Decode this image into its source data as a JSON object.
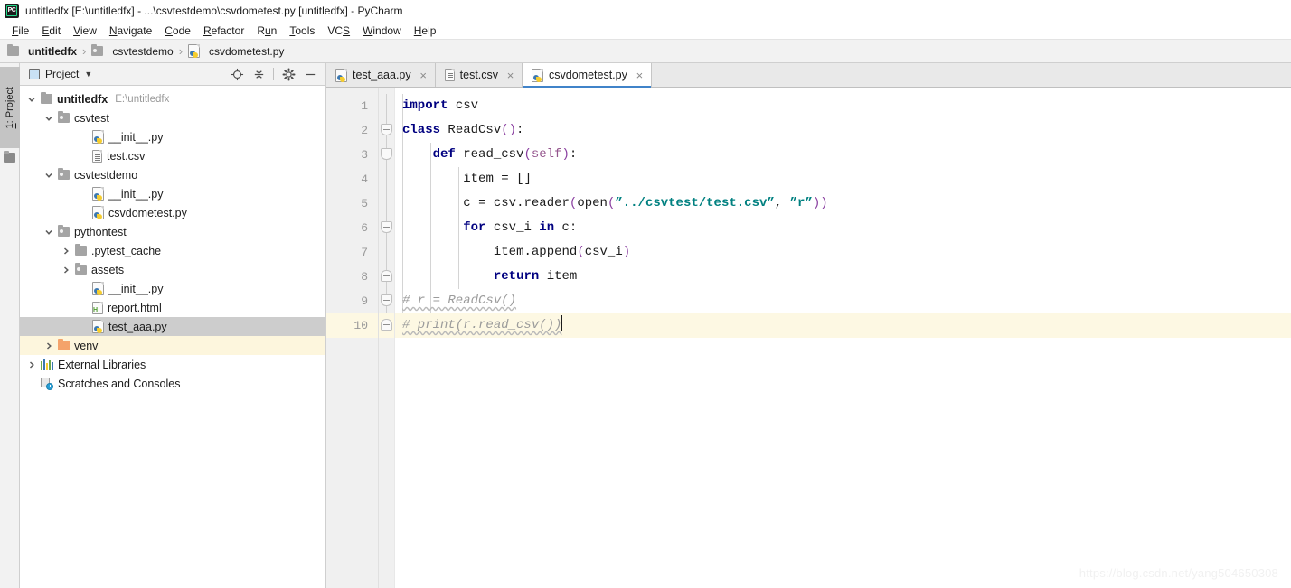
{
  "window": {
    "app_icon": "pycharm-logo-icon",
    "title": "untitledfx [E:\\untitledfx] - ...\\csvtestdemo\\csvdometest.py [untitledfx] - PyCharm"
  },
  "menubar": {
    "items": [
      {
        "label": "File",
        "mnemonic": "F"
      },
      {
        "label": "Edit",
        "mnemonic": "E"
      },
      {
        "label": "View",
        "mnemonic": "V"
      },
      {
        "label": "Navigate",
        "mnemonic": "N"
      },
      {
        "label": "Code",
        "mnemonic": "C"
      },
      {
        "label": "Refactor",
        "mnemonic": "R"
      },
      {
        "label": "Run",
        "mnemonic": "u"
      },
      {
        "label": "Tools",
        "mnemonic": "T"
      },
      {
        "label": "VCS",
        "mnemonic": "S"
      },
      {
        "label": "Window",
        "mnemonic": "W"
      },
      {
        "label": "Help",
        "mnemonic": "H"
      }
    ]
  },
  "breadcrumb": {
    "separator": "›",
    "items": [
      {
        "label": "untitledfx",
        "icon": "folder-icon",
        "bold": true
      },
      {
        "label": "csvtestdemo",
        "icon": "source-folder-icon",
        "bold": false
      },
      {
        "label": "csvdometest.py",
        "icon": "python-file-icon",
        "bold": false
      }
    ]
  },
  "toolstrip": {
    "project_tab": "1: Project",
    "project_tab_mnemonic": "1",
    "project_tab_icon": "project-folder-icon"
  },
  "project_panel": {
    "title": "Project",
    "title_icon": "project-view-icon",
    "caret_icon": "chevron-down-icon",
    "actions": [
      {
        "name": "scroll-from-source-button",
        "icon": "target-icon"
      },
      {
        "name": "collapse-all-button",
        "icon": "collapse-all-icon"
      },
      {
        "name": "settings-button",
        "icon": "gear-icon"
      },
      {
        "name": "hide-button",
        "icon": "minus-icon"
      }
    ],
    "tree": [
      {
        "label": "untitledfx",
        "sub": "E:\\untitledfx",
        "icon": "folder-icon",
        "depth": 0,
        "expander": "expanded",
        "bold": true,
        "state": "none"
      },
      {
        "label": "csvtest",
        "sub": "",
        "icon": "source-folder-icon",
        "depth": 1,
        "expander": "expanded",
        "bold": false,
        "state": "none"
      },
      {
        "label": "__init__.py",
        "sub": "",
        "icon": "python-file-icon",
        "depth": 3,
        "expander": "none",
        "bold": false,
        "state": "none"
      },
      {
        "label": "test.csv",
        "sub": "",
        "icon": "csv-file-icon",
        "depth": 3,
        "expander": "none",
        "bold": false,
        "state": "none"
      },
      {
        "label": "csvtestdemo",
        "sub": "",
        "icon": "source-folder-icon",
        "depth": 1,
        "expander": "expanded",
        "bold": false,
        "state": "none"
      },
      {
        "label": "__init__.py",
        "sub": "",
        "icon": "python-file-icon",
        "depth": 3,
        "expander": "none",
        "bold": false,
        "state": "none"
      },
      {
        "label": "csvdometest.py",
        "sub": "",
        "icon": "python-file-icon",
        "depth": 3,
        "expander": "none",
        "bold": false,
        "state": "none"
      },
      {
        "label": "pythontest",
        "sub": "",
        "icon": "source-folder-icon",
        "depth": 1,
        "expander": "expanded",
        "bold": false,
        "state": "none"
      },
      {
        "label": ".pytest_cache",
        "sub": "",
        "icon": "folder-icon",
        "depth": 2,
        "expander": "collapsed",
        "bold": false,
        "state": "none"
      },
      {
        "label": "assets",
        "sub": "",
        "icon": "source-folder-icon",
        "depth": 2,
        "expander": "collapsed",
        "bold": false,
        "state": "none"
      },
      {
        "label": "__init__.py",
        "sub": "",
        "icon": "python-file-icon",
        "depth": 3,
        "expander": "none",
        "bold": false,
        "state": "none"
      },
      {
        "label": "report.html",
        "sub": "",
        "icon": "html-file-icon",
        "depth": 3,
        "expander": "none",
        "bold": false,
        "state": "none"
      },
      {
        "label": "test_aaa.py",
        "sub": "",
        "icon": "python-file-icon",
        "depth": 3,
        "expander": "none",
        "bold": false,
        "state": "selected"
      },
      {
        "label": "venv",
        "sub": "",
        "icon": "excluded-folder-icon",
        "depth": 1,
        "expander": "collapsed",
        "bold": false,
        "state": "highlighted"
      },
      {
        "label": "External Libraries",
        "sub": "",
        "icon": "libraries-icon",
        "depth": 0,
        "expander": "collapsed",
        "bold": false,
        "state": "none"
      },
      {
        "label": "Scratches and Consoles",
        "sub": "",
        "icon": "scratches-icon",
        "depth": 0,
        "expander": "none",
        "bold": false,
        "state": "none"
      }
    ]
  },
  "editor": {
    "tabs": [
      {
        "label": "test_aaa.py",
        "icon": "python-file-icon",
        "active": false,
        "close_icon": "close-icon"
      },
      {
        "label": "test.csv",
        "icon": "csv-file-icon",
        "active": false,
        "close_icon": "close-icon"
      },
      {
        "label": "csvdometest.py",
        "icon": "python-file-icon",
        "active": true,
        "close_icon": "close-icon"
      }
    ],
    "active_tab": "csvdometest.py",
    "line_numbers": [
      "1",
      "2",
      "3",
      "4",
      "5",
      "6",
      "7",
      "8",
      "9",
      "10"
    ],
    "current_line": 10,
    "code_lines": [
      {
        "n": 1,
        "fold": "none",
        "text": "import csv"
      },
      {
        "n": 2,
        "fold": "start",
        "text": "class ReadCsv():"
      },
      {
        "n": 3,
        "fold": "start",
        "text": "    def read_csv(self):"
      },
      {
        "n": 4,
        "fold": "none",
        "text": "        item = []"
      },
      {
        "n": 5,
        "fold": "none",
        "text": "        c = csv.reader(open(\"../csvtest/test.csv\", \"r\"))"
      },
      {
        "n": 6,
        "fold": "start",
        "text": "        for csv_i in c:"
      },
      {
        "n": 7,
        "fold": "none",
        "text": "            item.append(csv_i)"
      },
      {
        "n": 8,
        "fold": "end",
        "text": "            return item"
      },
      {
        "n": 9,
        "fold": "start",
        "text": "# r = ReadCsv()"
      },
      {
        "n": 10,
        "fold": "end",
        "text": "# print(r.read_csv())"
      }
    ]
  },
  "watermark": {
    "text": "https://blog.csdn.net/yang504650308"
  },
  "colors": {
    "accent": "#4083c9",
    "keyword": "#000080",
    "string": "#008080",
    "comment": "#9b9b9b",
    "self_param": "#94558d",
    "paren": "#8a3fa0",
    "selection": "#cdcdcd",
    "highlight_row": "#fdf6dd",
    "current_line": "#fdf8e3",
    "panel_bg": "#f2f2f2",
    "gutter_bg": "#f0f0f0"
  }
}
